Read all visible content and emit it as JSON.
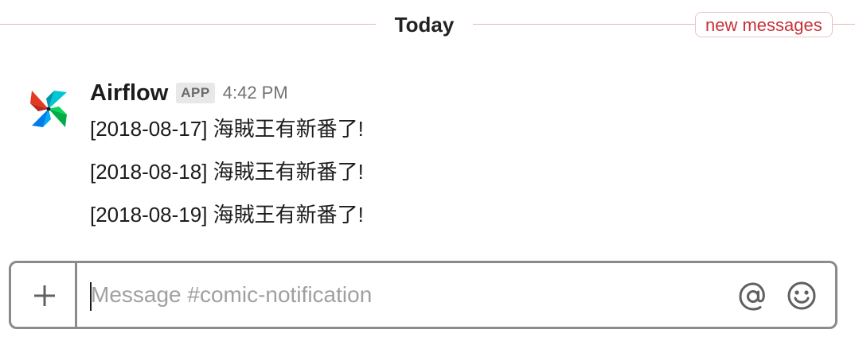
{
  "divider": {
    "day_label": "Today",
    "new_messages_label": "new messages"
  },
  "message": {
    "sender": "Airflow",
    "badge": "APP",
    "time": "4:42 PM",
    "lines": [
      "[2018-08-17] 海賊王有新番了!",
      "[2018-08-18] 海賊王有新番了!",
      "[2018-08-19] 海賊王有新番了!"
    ],
    "avatar_icon": "airflow-pinwheel-icon"
  },
  "composer": {
    "placeholder": "Message #comic-notification",
    "value": "",
    "add_icon": "plus-icon",
    "mention_icon": "at-sign-icon",
    "emoji_icon": "smiley-icon"
  },
  "colors": {
    "divider_rule": "#e6b7b7",
    "new_messages_text": "#c7323b",
    "composer_border": "#8b8b8b",
    "timestamp": "#717274",
    "placeholder": "#a0a0a2",
    "logo_red": "#e43921",
    "logo_blue": "#00adef",
    "logo_green": "#00c7d4",
    "logo_dark": "#11e1ee"
  }
}
